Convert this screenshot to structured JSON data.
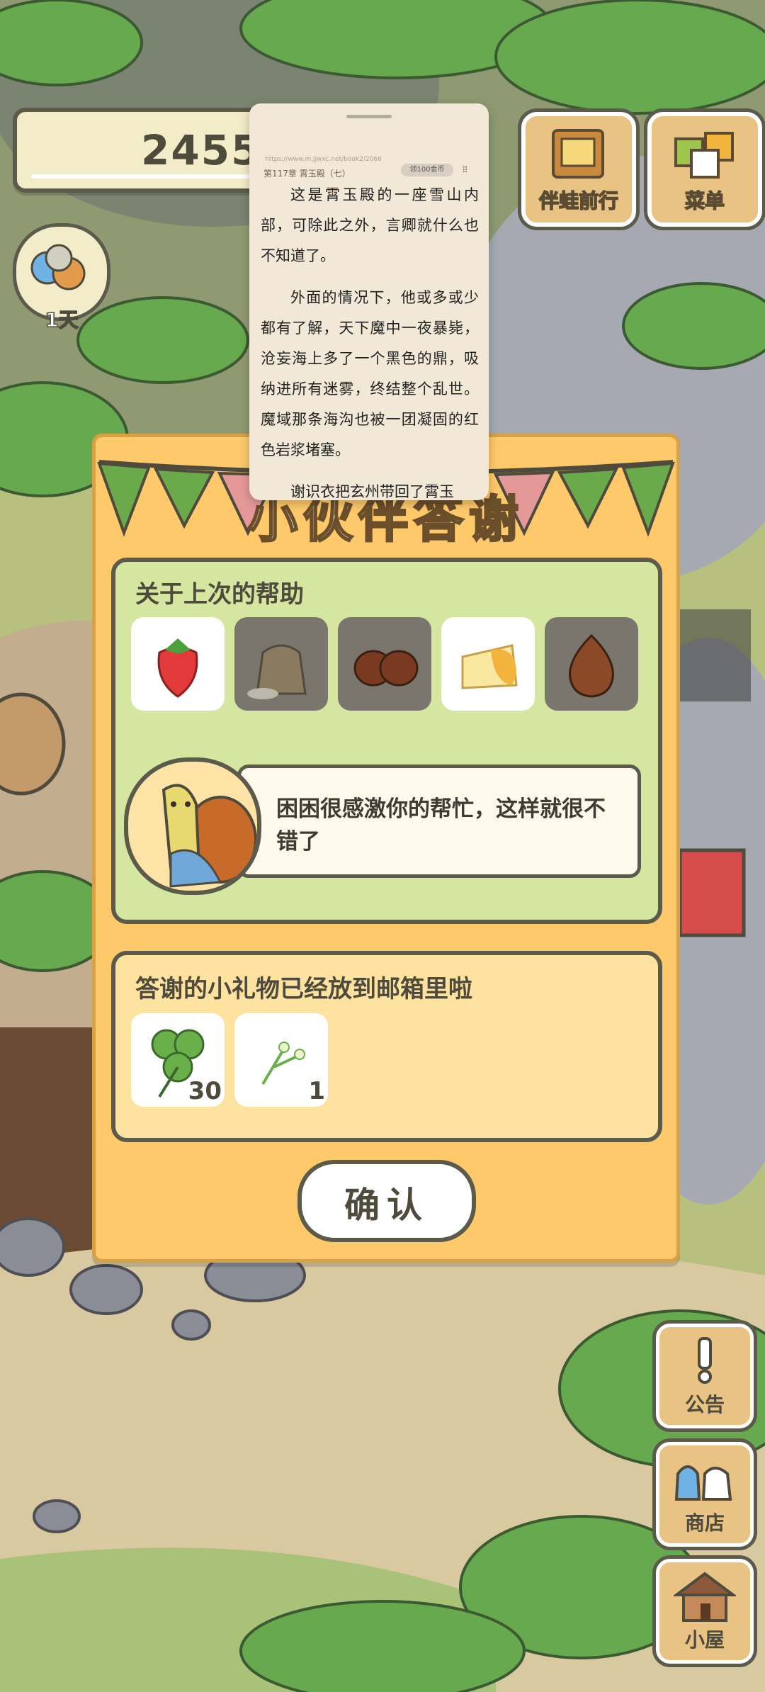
{
  "hud": {
    "clover_count": "2455",
    "days_label": "1天",
    "companion_button": "伴蛙前行",
    "menu_button": "菜单",
    "notice_button": "公告",
    "shop_button": "商店",
    "house_button": "小屋"
  },
  "reader": {
    "url": "https://www.m.jjwxc.net/book2/2066",
    "chapter": "第117章 霄玉殿（七）",
    "coins_badge": "领100金币",
    "paragraphs": [
      "这是霄玉殿的一座雪山内部，可除此之外，言卿就什么也不知道了。",
      "外面的情况下，他或多或少都有了解，天下魔中一夜暴毙，沧妄海上多了一个黑色的鼎，吸纳进所有迷雾，终结整个乱世。魔域那条海沟也被一团凝固的红色岩浆堵塞。",
      "谢识衣把玄州带回了霄玉"
    ]
  },
  "dialog": {
    "title": "小伙伴答谢",
    "help_section_title": "关于上次的帮助",
    "items": [
      {
        "icon": "strawberry-icon",
        "owned": true
      },
      {
        "icon": "flour-sack-icon",
        "owned": false
      },
      {
        "icon": "chestnut-icon",
        "owned": false
      },
      {
        "icon": "cheese-icon",
        "owned": true
      },
      {
        "icon": "onion-icon",
        "owned": false
      }
    ],
    "speech": "困困很感激你的帮忙，这样就很不错了",
    "gift_section_title": "答谢的小礼物已经放到邮箱里啦",
    "gifts": [
      {
        "icon": "clover-icon",
        "count": "30"
      },
      {
        "icon": "flower-sprig-icon",
        "count": "1"
      }
    ],
    "confirm_label": "确认"
  },
  "colors": {
    "dialog_bg": "#fdc96a",
    "section_green": "#d5e6a0",
    "section_cream": "#fee3a0",
    "outline": "#5b5a4b"
  }
}
